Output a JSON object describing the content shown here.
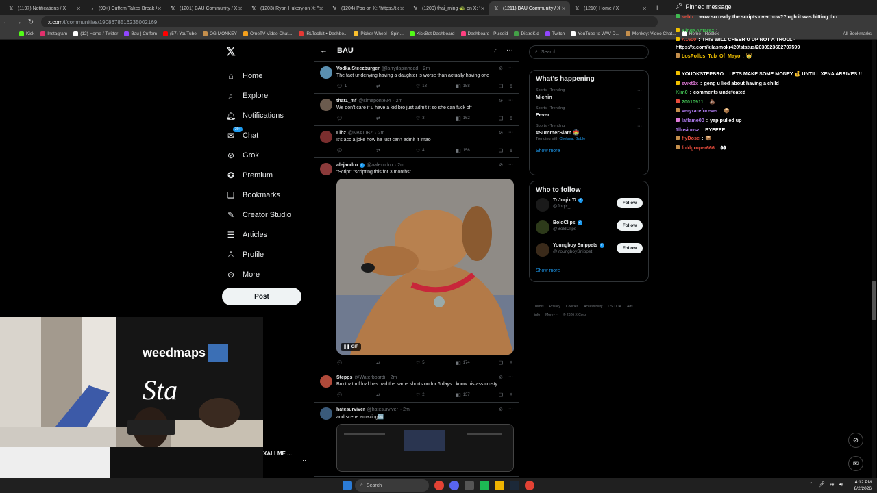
{
  "browser": {
    "tabs": [
      {
        "label": "(1197) Notifications / X",
        "icon": "x-icon",
        "active": false
      },
      {
        "label": "(99+) Cuffem Takes Break After",
        "icon": "tiktok-icon",
        "active": false
      },
      {
        "label": "(1201) BAU Community / X",
        "icon": "x-icon",
        "active": false
      },
      {
        "label": "(1203) Ryan Hukery on X: \"After",
        "icon": "x-icon",
        "active": false
      },
      {
        "label": "(1204) Poo on X: \"https://t.co/",
        "icon": "x-icon",
        "active": false
      },
      {
        "label": "(1209) thai_ming 🐢 on X: \"inu",
        "icon": "x-icon",
        "active": false
      },
      {
        "label": "(1211) BAU Community / X",
        "icon": "x-icon",
        "active": true
      },
      {
        "label": "(1210) Home / X",
        "icon": "x-icon",
        "active": false
      }
    ],
    "url_prefix": "x.com",
    "url_rest": "/i/communities/1908678516235002169",
    "bookmarks": [
      {
        "label": "Kick",
        "color": "#53fc18"
      },
      {
        "label": "Instagram",
        "color": "#e1306c"
      },
      {
        "label": "(12) Home / Twitter",
        "color": "#ffffff"
      },
      {
        "label": "Bau | Cuffem",
        "color": "#9146ff"
      },
      {
        "label": "(57) YouTube",
        "color": "#ff0000"
      },
      {
        "label": "OG MONKEY",
        "color": "#c58f4c"
      },
      {
        "label": "OmeTV Video Chat...",
        "color": "#f4a01c"
      },
      {
        "label": "IRLToolkit • Dashbo...",
        "color": "#e53935"
      },
      {
        "label": "Picker Wheel - Spin...",
        "color": "#fbc02d"
      },
      {
        "label": "KickBot Dashboard",
        "color": "#53fc18"
      },
      {
        "label": "Dashboard - Pulsoid",
        "color": "#ff4081"
      },
      {
        "label": "DistroKid",
        "color": "#43a047"
      },
      {
        "label": "Twitch",
        "color": "#9146ff"
      },
      {
        "label": "YouTube to WAV D...",
        "color": "#ffffff"
      },
      {
        "label": "Monkey: Video Chat...",
        "color": "#c58f4c"
      },
      {
        "label": "Home - Roblox",
        "color": "#ffffff"
      }
    ],
    "all_bookmarks": "All Bookmarks"
  },
  "nav": {
    "items": [
      {
        "label": "Home",
        "icon": "home-icon",
        "glyph": "⌂"
      },
      {
        "label": "Explore",
        "icon": "search-icon",
        "glyph": "⌕"
      },
      {
        "label": "Notifications",
        "icon": "bell-icon",
        "glyph": "🔔︎"
      },
      {
        "label": "Chat",
        "icon": "chat-icon",
        "glyph": "✉"
      },
      {
        "label": "Grok",
        "icon": "grok-icon",
        "glyph": "⊘"
      },
      {
        "label": "Premium",
        "icon": "premium-icon",
        "glyph": "✪"
      },
      {
        "label": "Bookmarks",
        "icon": "bookmark-icon",
        "glyph": "❑"
      },
      {
        "label": "Creator Studio",
        "icon": "creator-studio-icon",
        "glyph": "✎"
      },
      {
        "label": "Articles",
        "icon": "articles-icon",
        "glyph": "☰"
      },
      {
        "label": "Profile",
        "icon": "profile-icon",
        "glyph": "♙"
      },
      {
        "label": "More",
        "icon": "more-circle-icon",
        "glyph": "⊙"
      }
    ],
    "chat_badge": "20+",
    "post_label": "Post",
    "account_name": "XALLME ..."
  },
  "timeline": {
    "title": "BAU",
    "posts": [
      {
        "name": "Vodka Steezburger",
        "handle": "@larrydapinhead",
        "time": "· 2m",
        "text": "The fact ur denying having a daughter is worse than actually having one",
        "replies": "1",
        "reposts": "",
        "likes": "13",
        "views": "158",
        "avatar_color": "#5a8fb0",
        "verified": false
      },
      {
        "name": "that1_mf",
        "handle": "@slmeponte24",
        "time": "· 2m",
        "text": "We don't care if u have a kid bro just admit it so she can fuck off",
        "replies": "",
        "reposts": "",
        "likes": "3",
        "views": "162",
        "avatar_color": "#6b5b4e",
        "verified": false
      },
      {
        "name": "Libz",
        "handle": "@NBALIBZ",
        "time": "· 2m",
        "text": "It's acc a joke how he just can't admit it lmao",
        "replies": "",
        "reposts": "",
        "likes": "4",
        "views": "156",
        "avatar_color": "#7a2e2e",
        "verified": false
      },
      {
        "name": "alejandro",
        "handle": "@aalexndro",
        "time": "· 2m",
        "text": "“Script” “scripting this for 3 months”",
        "replies": "",
        "reposts": "",
        "likes": "5",
        "views": "174",
        "avatar_color": "#8b3a3a",
        "verified": true,
        "gif_label": "GIF"
      },
      {
        "name": "Stepps",
        "handle": "@Waterboardi",
        "time": "· 2m",
        "text": "Bro that mf loaf has had the same shorts on for 6 days I know his ass crusty",
        "replies": "",
        "reposts": "",
        "likes": "2",
        "views": "137",
        "avatar_color": "#b04a3a",
        "verified": false
      },
      {
        "name": "hatesurviver",
        "handle": "@hatesurviver",
        "time": "· 2m",
        "text": "and scene amazing🆒 !",
        "avatar_color": "#3a5a7a",
        "verified": false
      }
    ]
  },
  "sidebar": {
    "search_placeholder": "Search",
    "happening_title": "What’s happening",
    "trends": [
      {
        "category": "Sports · Trending",
        "name": "Michin",
        "with": "",
        "links": ""
      },
      {
        "category": "Sports · Trending",
        "name": "Fever",
        "with": "",
        "links": ""
      },
      {
        "category": "Sports · Trending",
        "name": "#SummerSlam 🏟️",
        "with": "Trending with",
        "links": "Chelsea, Gable"
      }
    ],
    "show_more": "Show more",
    "follow_title": "Who to follow",
    "follow": [
      {
        "name": "Ɗ Jnqix Ɗ",
        "handle": "@Jnqix_",
        "button": "Follow"
      },
      {
        "name": "BoldClips",
        "handle": "@BoldClips",
        "button": "Follow"
      },
      {
        "name": "Youngboy Snippets",
        "handle": "@YoungboySnippet",
        "button": "Follow"
      }
    ],
    "footer": [
      "Terms",
      "Privacy",
      "Cookies",
      "Accessibility",
      "US TIDA",
      "Ads info",
      "More ···",
      "© 2026 X Corp."
    ]
  },
  "chat": {
    "pinned_label": "Pinned message",
    "messages": [
      {
        "user": "sebb",
        "user_color": "#e74c3c",
        "text": "wow so really the scripts over now?? ugh it was hitting tho",
        "badge_color": "#3fb950"
      },
      {
        "user": "KingXAntarez",
        "user_color": "#3fb950",
        "text": "",
        "badge_color": "#f0c000"
      },
      {
        "user": "A1600",
        "user_color": "#e74c3c",
        "text": "THIS WILL CHEER U UP NOT A TROLL -",
        "badge_color": "#f0c000"
      },
      {
        "user": "",
        "user_color": "#ffffff",
        "text": "https://x.com/kilasmokr420/status/2030923602707599",
        "badge_color": ""
      },
      {
        "user": "LosPollos_Tub_Of_Mayo",
        "user_color": "#f0c000",
        "text": "👑",
        "badge_color": "#c58f4c"
      },
      {
        "user": "YOUOKSTEPBRO",
        "user_color": "#ffffff",
        "text": "LETS MAKE SOME MONEY 💰 UNTILL XENA ARRIVES !!",
        "badge_color": "#f0c000"
      },
      {
        "user": "swxt1x",
        "user_color": "#e07ad8",
        "text": "geng u lied about having a child",
        "badge_color": "#f0c000"
      },
      {
        "user": "Kim0",
        "user_color": "#3fb950",
        "text": "comments undefeated",
        "badge_color": ""
      },
      {
        "user": "20010911",
        "user_color": "#3fb950",
        "text": "💩",
        "badge_color": "#e74c3c"
      },
      {
        "user": "veryrareforever",
        "user_color": "#b07cf0",
        "text": "📦",
        "badge_color": "#c58f4c"
      },
      {
        "user": "laflame00",
        "user_color": "#b07cf0",
        "text": "yap pulled up",
        "badge_color": "#e07ad8"
      },
      {
        "user": "1llusionsz",
        "user_color": "#b07cf0",
        "text": "BYEEEE",
        "badge_color": ""
      },
      {
        "user": "flyDose",
        "user_color": "#e74c3c",
        "text": "📦",
        "badge_color": "#c58f4c"
      },
      {
        "user": "foldgroper666",
        "user_color": "#e74c3c",
        "text": "👀",
        "badge_color": "#c58f4c"
      }
    ]
  },
  "webcam": {
    "banner_text": "weedmaps",
    "sign_text": "Sta"
  },
  "taskbar": {
    "search_label": "Search",
    "time": "4:12 PM",
    "date": "8/2/2026"
  }
}
